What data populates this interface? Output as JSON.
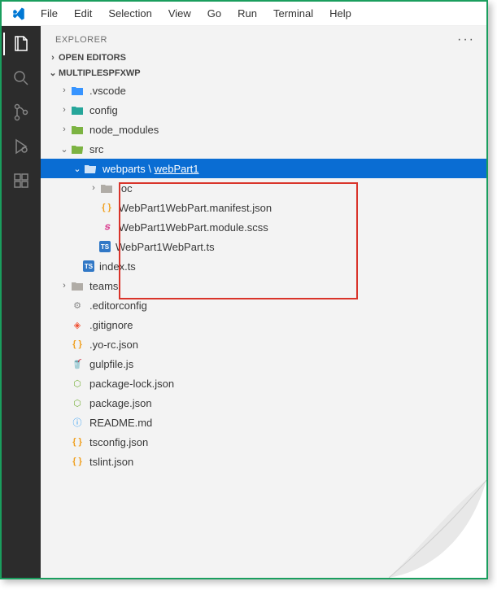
{
  "menubar": {
    "items": [
      "File",
      "Edit",
      "Selection",
      "View",
      "Go",
      "Run",
      "Terminal",
      "Help"
    ]
  },
  "sidebar": {
    "title": "EXPLORER",
    "sections": {
      "openEditors": "OPEN EDITORS",
      "workspace": "MULTIPLESPFXWP"
    }
  },
  "tree": {
    "vscode": ".vscode",
    "config": "config",
    "nodeModules": "node_modules",
    "src": "src",
    "webpartsPath": "webparts",
    "webPart1": "webPart1",
    "loc": "loc",
    "manifestJson": "WebPart1WebPart.manifest.json",
    "moduleScss": "WebPart1WebPart.module.scss",
    "webPartTs": "WebPart1WebPart.ts",
    "indexTs": "index.ts",
    "teams": "teams",
    "editorconfig": ".editorconfig",
    "gitignore": ".gitignore",
    "yoRc": ".yo-rc.json",
    "gulpfile": "gulpfile.js",
    "packageLock": "package-lock.json",
    "packageJson": "package.json",
    "readme": "README.md",
    "tsconfig": "tsconfig.json",
    "tslint": "tslint.json"
  }
}
